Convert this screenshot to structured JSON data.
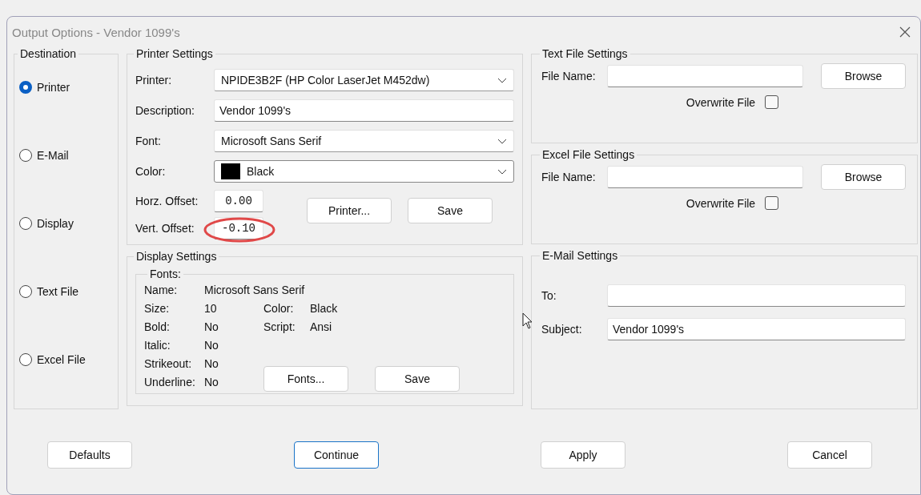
{
  "window": {
    "title": "Output Options - Vendor 1099's"
  },
  "destination": {
    "title": "Destination",
    "options": [
      {
        "label": "Printer",
        "selected": true
      },
      {
        "label": "E-Mail",
        "selected": false
      },
      {
        "label": "Display",
        "selected": false
      },
      {
        "label": "Text File",
        "selected": false
      },
      {
        "label": "Excel File",
        "selected": false
      }
    ]
  },
  "printer_settings": {
    "title": "Printer Settings",
    "fields": [
      {
        "kind": "dropdown",
        "label": "Printer:",
        "value": "NPIDE3B2F (HP Color LaserJet M452dw)"
      },
      {
        "kind": "text",
        "label": "Description:",
        "value": "Vendor 1099's"
      },
      {
        "kind": "dropdown",
        "label": "Font:",
        "value": "Microsoft Sans Serif"
      },
      {
        "kind": "color",
        "label": "Color:",
        "value": "Black",
        "color": "#000000"
      }
    ],
    "offsets": [
      {
        "label": "Horz. Offset:",
        "value": "0.00",
        "circled": false
      },
      {
        "label": "Vert. Offset:",
        "value": "-0.10",
        "circled": true
      }
    ],
    "buttons": [
      "Printer...",
      "Save"
    ]
  },
  "display_settings": {
    "title": "Display Settings",
    "fonts_title": "Fonts:",
    "font_props": [
      {
        "label": "Name:",
        "value": "Microsoft Sans Serif"
      },
      {
        "label": "Size:",
        "value": "10"
      },
      {
        "label": "Bold:",
        "value": "No"
      },
      {
        "label": "Italic:",
        "value": "No"
      },
      {
        "label": "Strikeout:",
        "value": "No"
      },
      {
        "label": "Underline:",
        "value": "No"
      }
    ],
    "extra_props": [
      {
        "label": "Color:",
        "value": "Black"
      },
      {
        "label": "Script:",
        "value": "Ansi"
      }
    ],
    "buttons": [
      "Fonts...",
      "Save"
    ]
  },
  "text_file_settings": {
    "title": "Text File Settings",
    "file_name_label": "File Name:",
    "browse": "Browse",
    "overwrite": {
      "label": "Overwrite File",
      "checked": false
    }
  },
  "excel_file_settings": {
    "title": "Excel File Settings",
    "file_name_label": "File Name:",
    "browse": "Browse",
    "overwrite": {
      "label": "Overwrite File",
      "checked": false
    }
  },
  "email_settings": {
    "title": "E-Mail Settings",
    "to_label": "To:",
    "subject_label": "Subject:",
    "subject": "Vendor 1099's"
  },
  "buttons": [
    {
      "label": "Defaults",
      "default": false
    },
    {
      "label": "Continue",
      "default": true
    },
    {
      "label": "Apply",
      "default": false
    },
    {
      "label": "Cancel",
      "default": false
    }
  ]
}
